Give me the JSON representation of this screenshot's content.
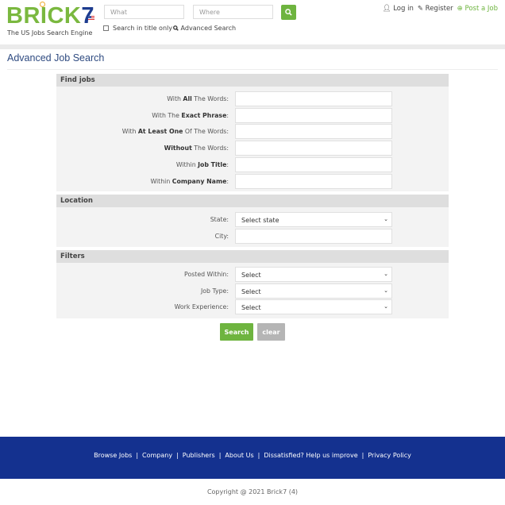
{
  "header": {
    "logo_main": "BRICK",
    "logo_num": "7",
    "tagline": "The US Jobs Search Engine",
    "what_placeholder": "What",
    "where_placeholder": "Where",
    "title_only_label": "Search in title only",
    "advanced_label": "Advanced Search",
    "login_label": "Log in",
    "register_label": "Register",
    "post_job_label": "Post a Job"
  },
  "page": {
    "title": "Advanced Job Search"
  },
  "find_jobs": {
    "heading": "Find jobs",
    "fields": [
      {
        "pre": "With ",
        "bold": "All",
        "post": " The Words:"
      },
      {
        "pre": "With The ",
        "bold": "Exact Phrase",
        "post": ":"
      },
      {
        "pre": "With ",
        "bold": "At Least One",
        "post": " Of The Words:"
      },
      {
        "pre": "",
        "bold": "Without",
        "post": " The Words:"
      },
      {
        "pre": "Within ",
        "bold": "Job Title",
        "post": ":"
      },
      {
        "pre": "Within ",
        "bold": "Company Name",
        "post": ":"
      }
    ]
  },
  "location": {
    "heading": "Location",
    "state_label": "State:",
    "state_value": "Select state",
    "city_label": "City:"
  },
  "filters": {
    "heading": "Filters",
    "posted_label": "Posted Within:",
    "posted_value": "Select",
    "jobtype_label": "Job Type:",
    "jobtype_value": "Select",
    "experience_label": "Work Experience:",
    "experience_value": "Select"
  },
  "actions": {
    "search_label": "Search",
    "clear_label": "clear"
  },
  "footer": {
    "links": [
      "Browse Jobs",
      "Company",
      "Publishers",
      "About Us",
      "Dissatisfied? Help us improve",
      "Privacy Policy"
    ],
    "separator": "|",
    "copyright": "Copyright @ 2021 Brick7 (4)"
  },
  "colors": {
    "brand_green": "#6eb43f",
    "brand_blue": "#14318f",
    "clear_gray": "#b5b5b5"
  }
}
